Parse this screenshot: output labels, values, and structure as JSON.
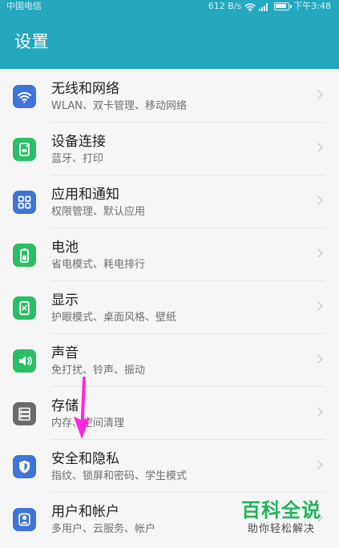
{
  "status_bar": {
    "carrier": "中国电信",
    "network_speed": "612 B/s",
    "time": "下午3:48"
  },
  "header": {
    "title": "设置"
  },
  "settings": [
    {
      "title": "无线和网络",
      "subtitle": "WLAN、双卡管理、移动网络",
      "icon": "wifi-icon",
      "color": "#3f74d8"
    },
    {
      "title": "设备连接",
      "subtitle": "蓝牙、打印",
      "icon": "device-connect-icon",
      "color": "#2cbe67"
    },
    {
      "title": "应用和通知",
      "subtitle": "权限管理、默认应用",
      "icon": "apps-icon",
      "color": "#3f74d8"
    },
    {
      "title": "电池",
      "subtitle": "省电模式、耗电排行",
      "icon": "battery-icon",
      "color": "#2cbe67"
    },
    {
      "title": "显示",
      "subtitle": "护眼模式、桌面风格、壁纸",
      "icon": "display-icon",
      "color": "#2cbe67"
    },
    {
      "title": "声音",
      "subtitle": "免打扰、铃声、振动",
      "icon": "sound-icon",
      "color": "#2cbe67"
    },
    {
      "title": "存储",
      "subtitle": "内存、空间清理",
      "icon": "storage-icon",
      "color": "#6b6b6b"
    },
    {
      "title": "安全和隐私",
      "subtitle": "指纹、锁屏和密码、学生模式",
      "icon": "security-icon",
      "color": "#3f74d8"
    },
    {
      "title": "用户和帐户",
      "subtitle": "多用户、云服务、帐户",
      "icon": "users-icon",
      "color": "#3f74d8"
    }
  ],
  "annotation": {
    "icon": "pointer-arrow-icon",
    "color": "#ff24df"
  },
  "watermark": {
    "logo": "百科全说",
    "tagline": "助你轻松解决",
    "color": "#21b35a"
  }
}
